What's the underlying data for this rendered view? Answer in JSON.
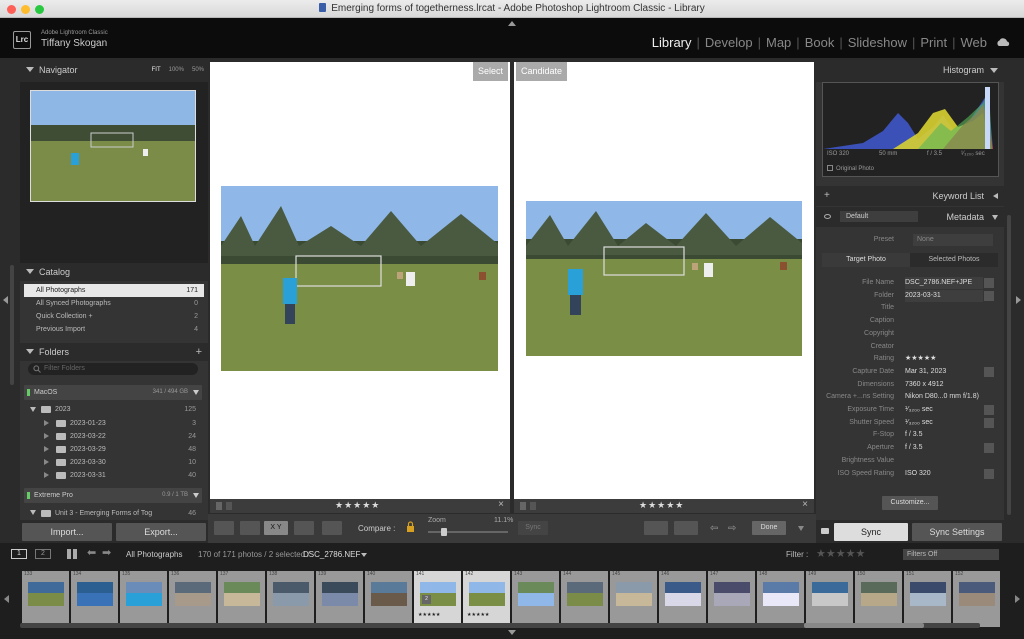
{
  "window": {
    "title": "Emerging forms of togetherness.lrcat - Adobe Photoshop Lightroom Classic - Library"
  },
  "identity": {
    "logo": "Lrc",
    "app_name": "Adobe Lightroom Classic",
    "user": "Tiffany Skogan"
  },
  "modules": [
    "Library",
    "Develop",
    "Map",
    "Book",
    "Slideshow",
    "Print",
    "Web"
  ],
  "active_module": "Library",
  "navigator": {
    "title": "Navigator",
    "zoom": [
      "FIT",
      "100%",
      "50%"
    ]
  },
  "catalog": {
    "title": "Catalog",
    "items": [
      {
        "label": "All Photographs",
        "count": "171"
      },
      {
        "label": "All Synced Photographs",
        "count": "0"
      },
      {
        "label": "Quick Collection +",
        "count": "2"
      },
      {
        "label": "Previous Import",
        "count": "4"
      }
    ]
  },
  "folders": {
    "title": "Folders",
    "filter_placeholder": "Filter Folders",
    "volume1": {
      "name": "MacOS",
      "capacity": "341 / 494 GB"
    },
    "year": {
      "label": "2023",
      "count": "125"
    },
    "subfolders": [
      {
        "label": "2023-01-23",
        "count": "3"
      },
      {
        "label": "2023-03-22",
        "count": "24"
      },
      {
        "label": "2023-03-29",
        "count": "48"
      },
      {
        "label": "2023-03-30",
        "count": "10"
      },
      {
        "label": "2023-03-31",
        "count": "40"
      }
    ],
    "volume2": {
      "name": "Extreme Pro",
      "capacity": "0.9 / 1 TB"
    },
    "unit": {
      "label": "Unit 3 - Emerging Forms of Tog",
      "count": "46"
    }
  },
  "left_buttons": {
    "import": "Import...",
    "export": "Export..."
  },
  "compare": {
    "select_label": "Select",
    "candidate_label": "Candidate",
    "select_stars": "★★★★★",
    "candidate_stars": "★★★★★"
  },
  "toolbar": {
    "compare_label": "Compare :",
    "zoom_label": "Zoom",
    "zoom_value": "11.1%",
    "zoom_fraction": 0.18,
    "sync_label": "Sync",
    "done_label": "Done",
    "xy_label": "X Y"
  },
  "histogram": {
    "title": "Histogram",
    "iso": "ISO 320",
    "focal": "50 mm",
    "aperture": "f / 3.5",
    "shutter": "¹⁄₃₂₀₀ sec",
    "original_photo": "Original Photo"
  },
  "keyword_list": "Keyword List",
  "metadata": {
    "title": "Metadata",
    "preset_default": "Default",
    "preset_label": "Preset",
    "preset_value": "None",
    "tab_target": "Target Photo",
    "tab_selected": "Selected Photos",
    "fields": [
      {
        "label": "File Name",
        "value": "DSC_2786.NEF+JPE"
      },
      {
        "label": "Folder",
        "value": "2023-03-31"
      },
      {
        "label": "Title",
        "value": ""
      },
      {
        "label": "Caption",
        "value": ""
      },
      {
        "label": "Copyright",
        "value": ""
      },
      {
        "label": "Creator",
        "value": ""
      },
      {
        "label": "Rating",
        "value": "★★★★★"
      },
      {
        "label": "Capture Date",
        "value": "Mar 31, 2023"
      },
      {
        "label": "Dimensions",
        "value": "7360 x 4912"
      },
      {
        "label": "Camera +...ns Setting",
        "value": "Nikon D80...0 mm f/1.8)"
      },
      {
        "label": "Exposure Time",
        "value": "¹⁄₃₂₀₀ sec"
      },
      {
        "label": "Shutter Speed",
        "value": "¹⁄₃₂₀₀ sec"
      },
      {
        "label": "F-Stop",
        "value": "f / 3.5"
      },
      {
        "label": "Aperture",
        "value": "f / 3.5"
      },
      {
        "label": "Brightness Value",
        "value": ""
      },
      {
        "label": "ISO Speed Rating",
        "value": "ISO 320"
      }
    ],
    "customize": "Customize..."
  },
  "right_buttons": {
    "sync": "Sync",
    "sync_settings": "Sync Settings"
  },
  "filmbar": {
    "page1": "1",
    "page2": "2",
    "source": "All Photographs",
    "status": "170 of 171 photos / 2 selected /",
    "filename": "DSC_2786.NEF",
    "filter_label": "Filter :",
    "filter_value": "Filters Off",
    "filter_stars": "★★★★★"
  },
  "filmstrip": {
    "cells": [
      {
        "num": "133"
      },
      {
        "num": "134"
      },
      {
        "num": "135"
      },
      {
        "num": "136"
      },
      {
        "num": "137"
      },
      {
        "num": "138"
      },
      {
        "num": "139"
      },
      {
        "num": "140"
      },
      {
        "num": "141",
        "selected": true,
        "stars": "★★★★★",
        "badge": "2"
      },
      {
        "num": "142",
        "selected": true,
        "stars": "★★★★★"
      },
      {
        "num": "143"
      },
      {
        "num": "144"
      },
      {
        "num": "145"
      },
      {
        "num": "146"
      },
      {
        "num": "147"
      },
      {
        "num": "148"
      },
      {
        "num": "149"
      },
      {
        "num": "150"
      },
      {
        "num": "151"
      },
      {
        "num": "152"
      }
    ]
  }
}
